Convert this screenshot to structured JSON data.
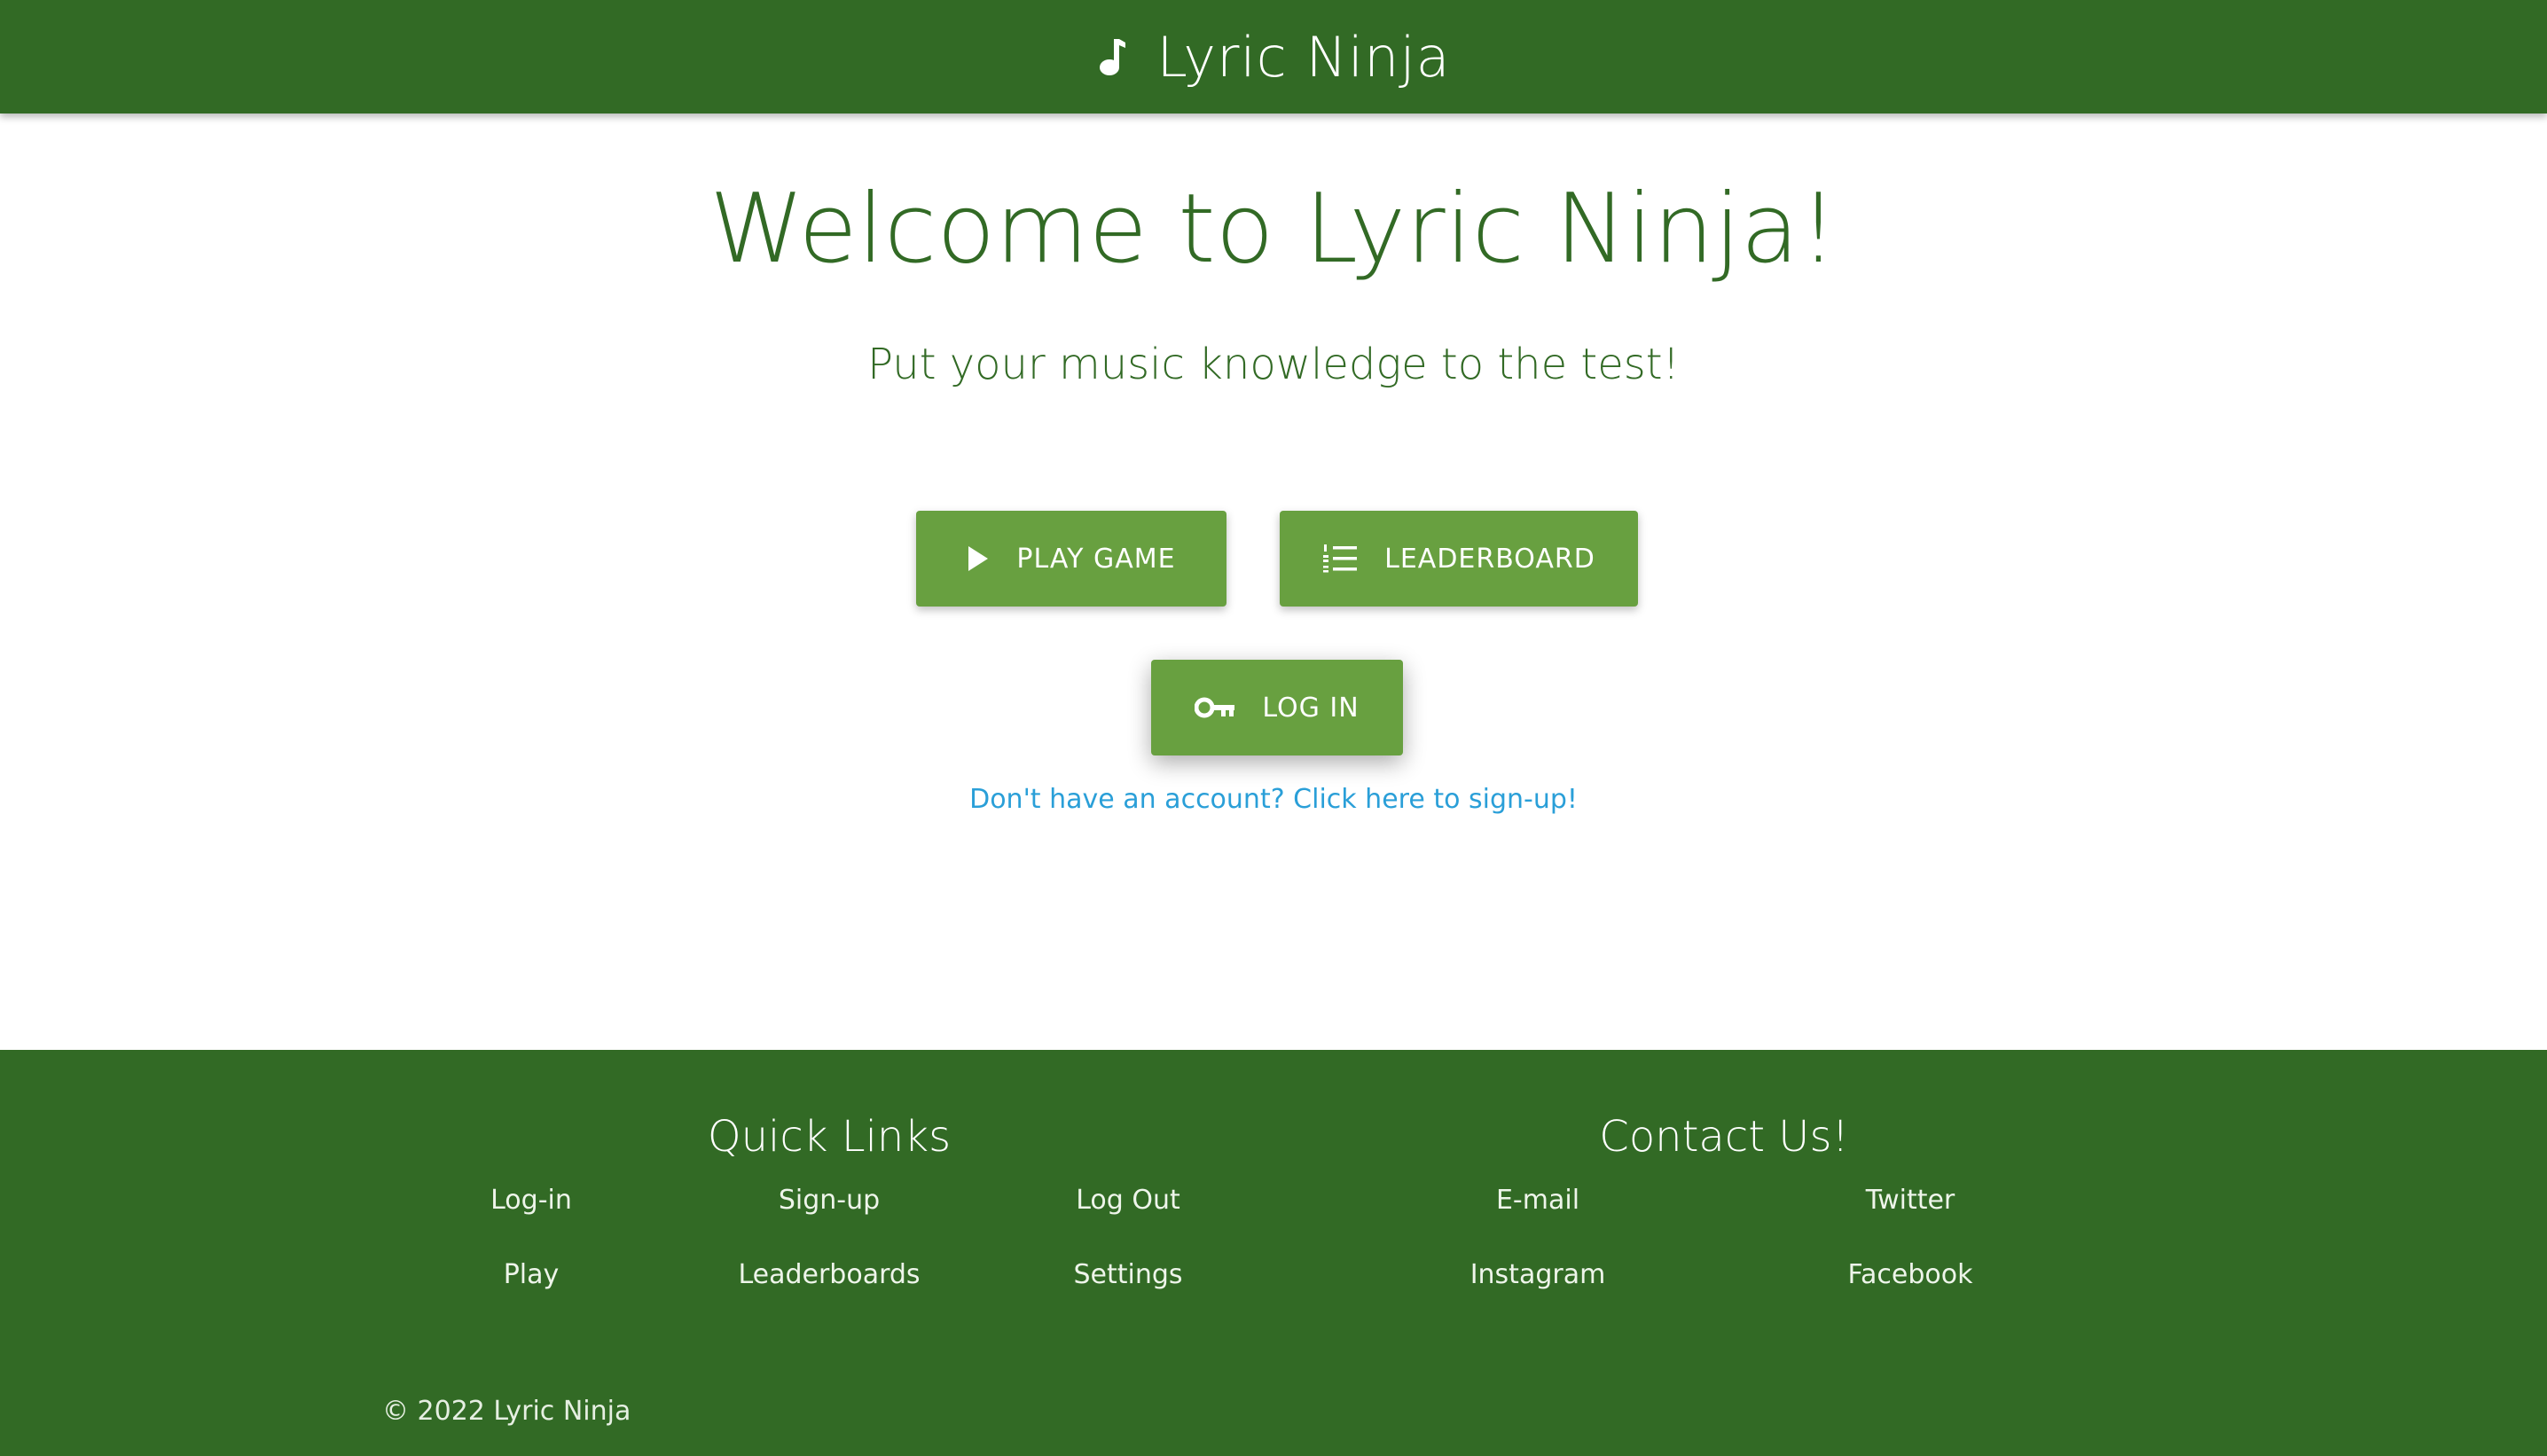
{
  "header": {
    "title": "Lyric Ninja",
    "icon": "music-note-icon"
  },
  "main": {
    "welcome": "Welcome to Lyric Ninja!",
    "subtitle": "Put your music knowledge to the test!",
    "buttons": {
      "play": {
        "label": "PLAY GAME",
        "icon": "play-icon"
      },
      "leaderboard": {
        "label": "LEADERBOARD",
        "icon": "numbered-list-icon"
      },
      "login": {
        "label": "LOG IN",
        "icon": "key-icon"
      }
    },
    "signup_link": "Don't have an account? Click here to sign-up!"
  },
  "footer": {
    "quick_links": {
      "heading": "Quick Links",
      "links": [
        "Log-in",
        "Sign-up",
        "Log Out",
        "Play",
        "Leaderboards",
        "Settings"
      ]
    },
    "contact": {
      "heading": "Contact Us!",
      "links": [
        "E-mail",
        "Twitter",
        "Instagram",
        "Facebook"
      ]
    },
    "copyright": "© 2022 Lyric Ninja"
  },
  "colors": {
    "primary_dark": "#326a25",
    "button": "#68a040",
    "link": "#2a9fd8",
    "background": "#ffffff"
  }
}
